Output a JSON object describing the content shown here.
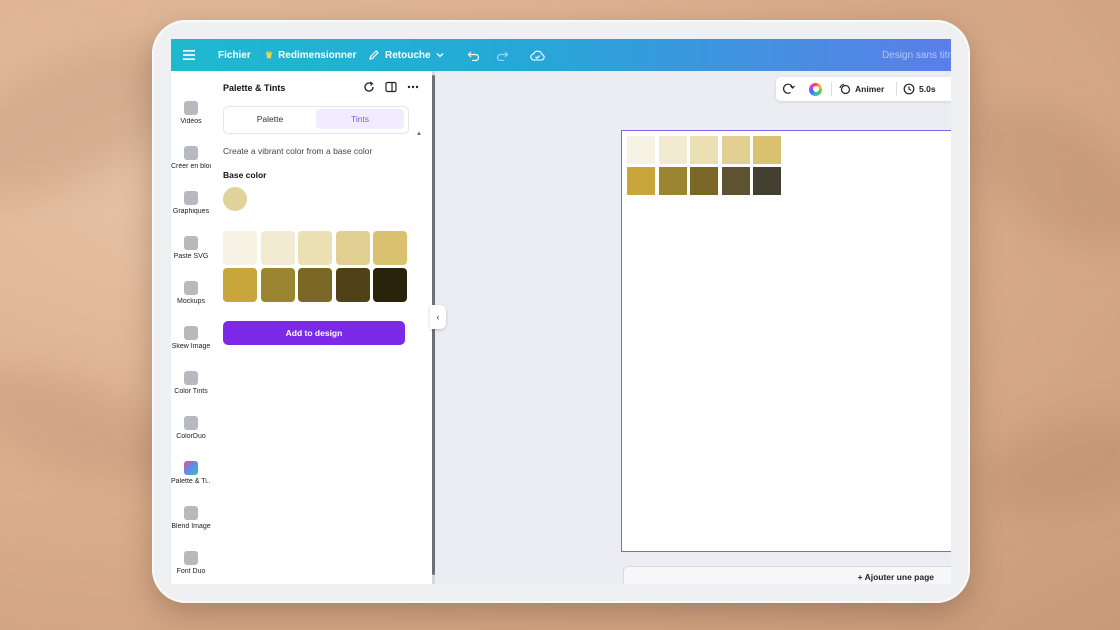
{
  "topbar": {
    "menu_icon": "hamburger-icon",
    "file_label": "Fichier",
    "resize_label": "Redimensionner",
    "resize_icon": "crown-icon",
    "edit_label": "Retouche",
    "edit_icon": "pencil-icon",
    "undo_icon": "undo-icon",
    "redo_icon": "redo-icon",
    "save_icon": "cloud-check-icon",
    "doc_title": "Design sans titre"
  },
  "rail": {
    "items": [
      {
        "label": "Vidéos",
        "icon": "video-icon"
      },
      {
        "label": "Créer en bloc",
        "icon": "bulk-create-icon"
      },
      {
        "label": "Graphiques",
        "icon": "charts-icon"
      },
      {
        "label": "Paste SVG",
        "icon": "paste-svg-icon"
      },
      {
        "label": "Mockups",
        "icon": "mockups-icon"
      },
      {
        "label": "Skew Image",
        "icon": "skew-image-icon"
      },
      {
        "label": "Color Tints",
        "icon": "color-tints-icon"
      },
      {
        "label": "ColorDuo",
        "icon": "colorduo-icon"
      },
      {
        "label": "Palette & Ti...",
        "icon": "palette-tints-icon",
        "active": true
      },
      {
        "label": "Blend Image",
        "icon": "blend-image-icon"
      },
      {
        "label": "Font Duo",
        "icon": "font-duo-icon"
      }
    ]
  },
  "panel": {
    "title": "Palette & Tints",
    "tabs": [
      "Palette",
      "Tints"
    ],
    "active_tab": "Tints",
    "description": "Create a vibrant color from a base color",
    "base_color_label": "Base color",
    "base_color": "#e0d29a",
    "tints": [
      "#f7f3e4",
      "#f2ead1",
      "#ebdfb4",
      "#e2d092",
      "#d9c16f"
    ],
    "shades": [
      "#c9a63c",
      "#9c8531",
      "#7b6726",
      "#4f4219",
      "#2a230c"
    ],
    "add_button": "Add to design"
  },
  "toolbar": {
    "animate_label": "Animer",
    "duration": "5.0s"
  },
  "canvas": {
    "row1": [
      "#f7f3e4",
      "#f2ead1",
      "#ebdfb4",
      "#e2d092",
      "#d9c16f"
    ],
    "row2": [
      "#c9a63c",
      "#9c8531",
      "#7b6726",
      "#5e5330",
      "#434031"
    ]
  },
  "add_page_label": "+ Ajouter une page"
}
